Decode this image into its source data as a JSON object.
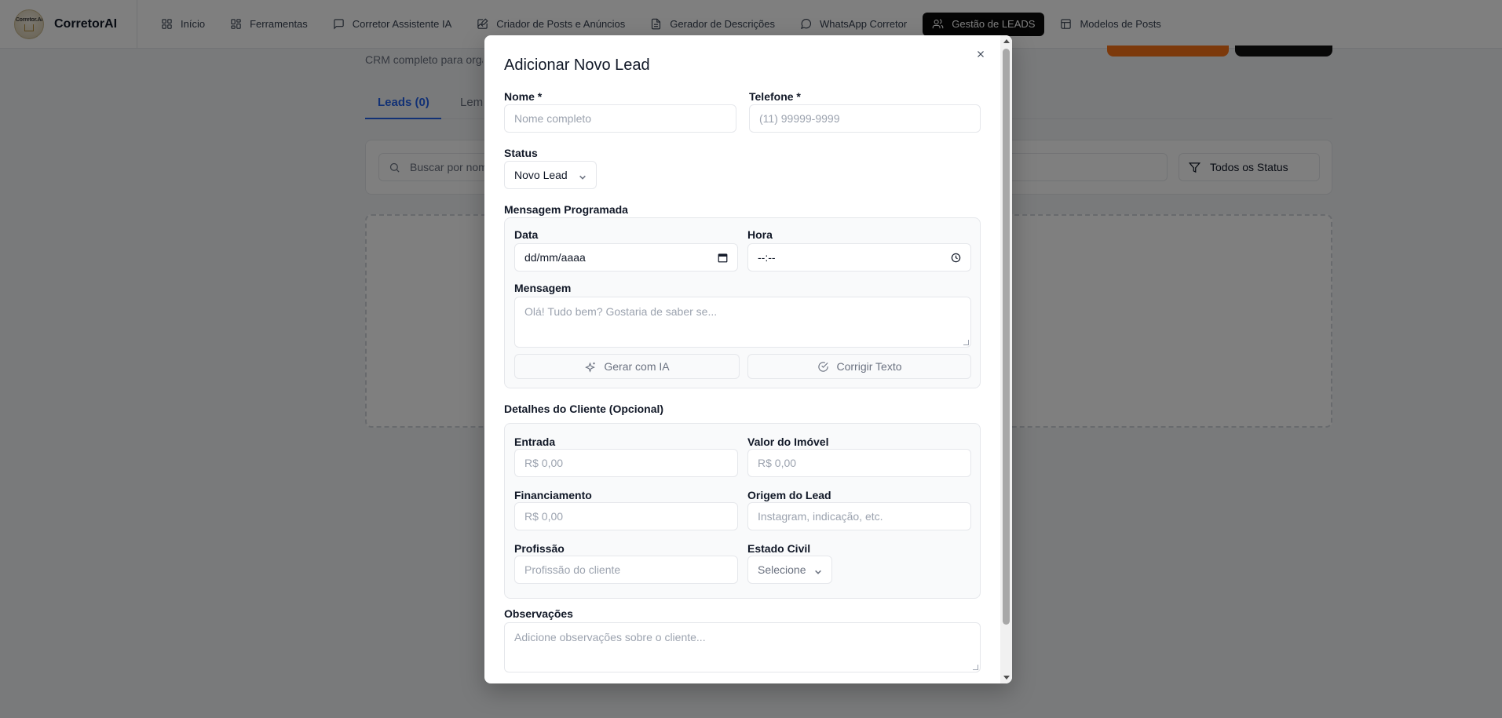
{
  "brand": {
    "logo_text": "Corretor.AI",
    "name": "CorretorAI"
  },
  "nav": [
    {
      "label": "Início",
      "icon": "grid-icon"
    },
    {
      "label": "Ferramentas",
      "icon": "grid-icon"
    },
    {
      "label": "Corretor Assistente IA",
      "icon": "chat-icon"
    },
    {
      "label": "Criador de Posts e Anúncios",
      "icon": "edit-image-icon"
    },
    {
      "label": "Gerador de Descrições",
      "icon": "document-icon"
    },
    {
      "label": "WhatsApp Corretor",
      "icon": "whatsapp-icon"
    },
    {
      "label": "Gestão de LEADS",
      "icon": "users-icon",
      "active": true
    },
    {
      "label": "Modelos de Posts",
      "icon": "layout-icon"
    }
  ],
  "background": {
    "subtitle": "CRM completo para orga",
    "tabs": {
      "leads": "Leads (0)",
      "second": "Lem"
    },
    "search_placeholder": "Buscar por nom",
    "status_filter": "Todos os Status"
  },
  "modal": {
    "title": "Adicionar Novo Lead",
    "nome": {
      "label": "Nome *",
      "placeholder": "Nome completo"
    },
    "telefone": {
      "label": "Telefone *",
      "placeholder": "(11) 99999-9999"
    },
    "status": {
      "label": "Status",
      "value": "Novo Lead"
    },
    "mensagem_programada": {
      "label": "Mensagem Programada",
      "data": {
        "label": "Data",
        "value": "dd/mm/aaaa"
      },
      "hora": {
        "label": "Hora",
        "value": "--:--"
      },
      "mensagem": {
        "label": "Mensagem",
        "placeholder": "Olá! Tudo bem? Gostaria de saber se..."
      },
      "gerar_ia": "Gerar com IA",
      "corrigir": "Corrigir Texto"
    },
    "detalhes": {
      "label": "Detalhes do Cliente (Opcional)",
      "entrada": {
        "label": "Entrada",
        "placeholder": "R$ 0,00"
      },
      "valor_imovel": {
        "label": "Valor do Imóvel",
        "placeholder": "R$ 0,00"
      },
      "financiamento": {
        "label": "Financiamento",
        "placeholder": "R$ 0,00"
      },
      "origem": {
        "label": "Origem do Lead",
        "placeholder": "Instagram, indicação, etc."
      },
      "profissao": {
        "label": "Profissão",
        "placeholder": "Profissão do cliente"
      },
      "estado_civil": {
        "label": "Estado Civil",
        "value": "Selecione"
      }
    },
    "observacoes": {
      "label": "Observações",
      "placeholder": "Adicione observações sobre o cliente..."
    }
  },
  "colors": {
    "accent_blue": "#2563eb",
    "active_nav": "#0b0b0b",
    "orange": "#f97316"
  }
}
